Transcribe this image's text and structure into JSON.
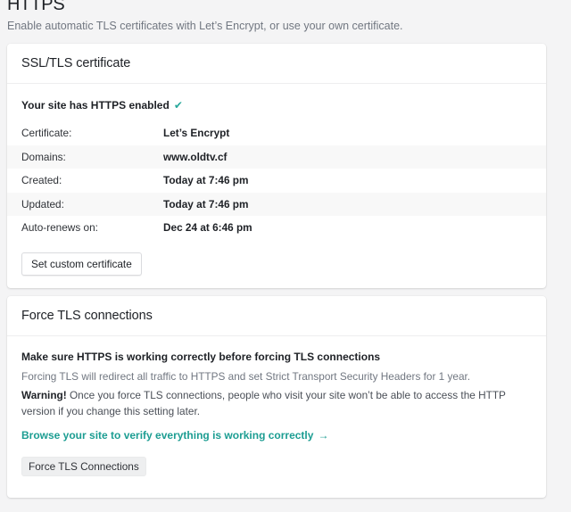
{
  "page": {
    "title": "HTTPS",
    "subtitle": "Enable automatic TLS certificates with Let’s Encrypt, or use your own certificate."
  },
  "ssl_card": {
    "title": "SSL/TLS certificate",
    "status_text": "Your site has HTTPS enabled",
    "status_icon": "checkmark-icon",
    "rows": [
      {
        "key": "Certificate:",
        "value": "Let’s Encrypt"
      },
      {
        "key": "Domains:",
        "value": "www.oldtv.cf"
      },
      {
        "key": "Created:",
        "value": "Today at 7:46 pm"
      },
      {
        "key": "Updated:",
        "value": "Today at 7:46 pm"
      },
      {
        "key": "Auto-renews on:",
        "value": "Dec 24 at 6:46 pm"
      }
    ],
    "button_label": "Set custom certificate"
  },
  "tls_card": {
    "title": "Force TLS connections",
    "heading": "Make sure HTTPS is working correctly before forcing TLS connections",
    "description": "Forcing TLS will redirect all traffic to HTTPS and set Strict Transport Security Headers for 1 year.",
    "warning_label": "Warning!",
    "warning_text": " Once you force TLS connections, people who visit your site won’t be able to access the HTTP version if you change this setting later.",
    "link_text": "Browse your site to verify everything is working correctly",
    "link_icon": "arrow-right-icon",
    "button_label": "Force TLS Connections"
  },
  "colors": {
    "accent": "#1c9d92",
    "background": "#f4f4f5",
    "card": "#ffffff",
    "muted_text": "#717781"
  }
}
